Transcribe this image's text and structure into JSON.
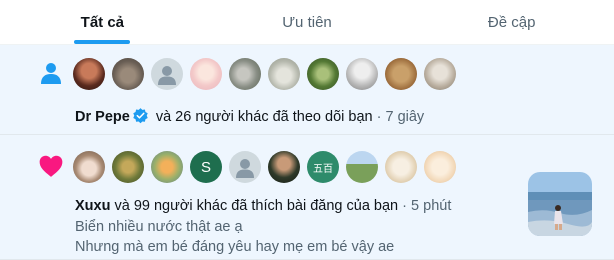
{
  "tabs": [
    {
      "label": "Tất cả",
      "active": true
    },
    {
      "label": "Ưu tiên",
      "active": false
    },
    {
      "label": "Đề cập",
      "active": false
    }
  ],
  "notifications": [
    {
      "type": "follow",
      "icon": "person-icon",
      "actor": "Dr Pepe",
      "verified": true,
      "text": "và 26 người khác đã theo dõi bạn",
      "separator": "·",
      "time": "7 giây",
      "avatar_count": 10
    },
    {
      "type": "like",
      "icon": "heart-icon",
      "actor": "Xuxu",
      "text": "và 99 người khác đã thích bài đăng của bạn",
      "separator": "·",
      "time": "5 phút",
      "post_line1": "Biển nhiều nước thật ae ạ",
      "post_line2": "Nhưng mà em bé đáng yêu hay mẹ em bé vậy ae",
      "avatar_letter": "S",
      "avatar_glyph": "五百",
      "avatar_count": 10
    }
  ],
  "colors": {
    "accent": "#1d9bf0",
    "follow_icon": "#1d9bf0",
    "like_icon": "#f91880",
    "notification_bg": "#eef6fe"
  }
}
